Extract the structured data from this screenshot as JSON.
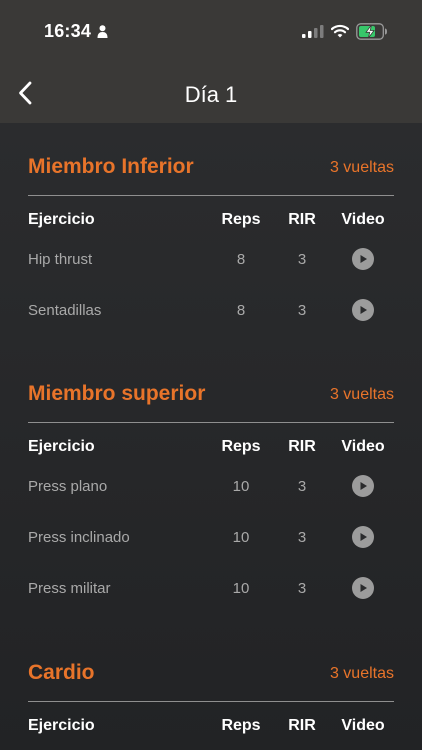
{
  "status_bar": {
    "time": "16:34",
    "icons": [
      "person-icon",
      "signal-icon",
      "wifi-icon",
      "battery-charging-icon"
    ]
  },
  "nav": {
    "back_icon": "chevron-left-icon",
    "title": "Día 1"
  },
  "table_headers": {
    "exercise": "Ejercicio",
    "reps": "Reps",
    "rir": "RIR",
    "video": "Video"
  },
  "sections": [
    {
      "title": "Miembro Inferior",
      "rounds": "3 vueltas",
      "rows": [
        {
          "exercise": "Hip thrust",
          "reps": "8",
          "rir": "3",
          "video_icon": "play-icon"
        },
        {
          "exercise": "Sentadillas",
          "reps": "8",
          "rir": "3",
          "video_icon": "play-icon"
        }
      ]
    },
    {
      "title": "Miembro superior",
      "rounds": "3 vueltas",
      "rows": [
        {
          "exercise": "Press plano",
          "reps": "10",
          "rir": "3",
          "video_icon": "play-icon"
        },
        {
          "exercise": "Press inclinado",
          "reps": "10",
          "rir": "3",
          "video_icon": "play-icon"
        },
        {
          "exercise": "Press militar",
          "reps": "10",
          "rir": "3",
          "video_icon": "play-icon"
        }
      ]
    },
    {
      "title": "Cardio",
      "rounds": "3 vueltas",
      "rows": []
    }
  ],
  "colors": {
    "accent": "#e8742a",
    "header_bg": "#3a3937",
    "body_bg": "#252628",
    "muted_text": "#a9a9a9",
    "play_button": "#9c9c9c"
  }
}
